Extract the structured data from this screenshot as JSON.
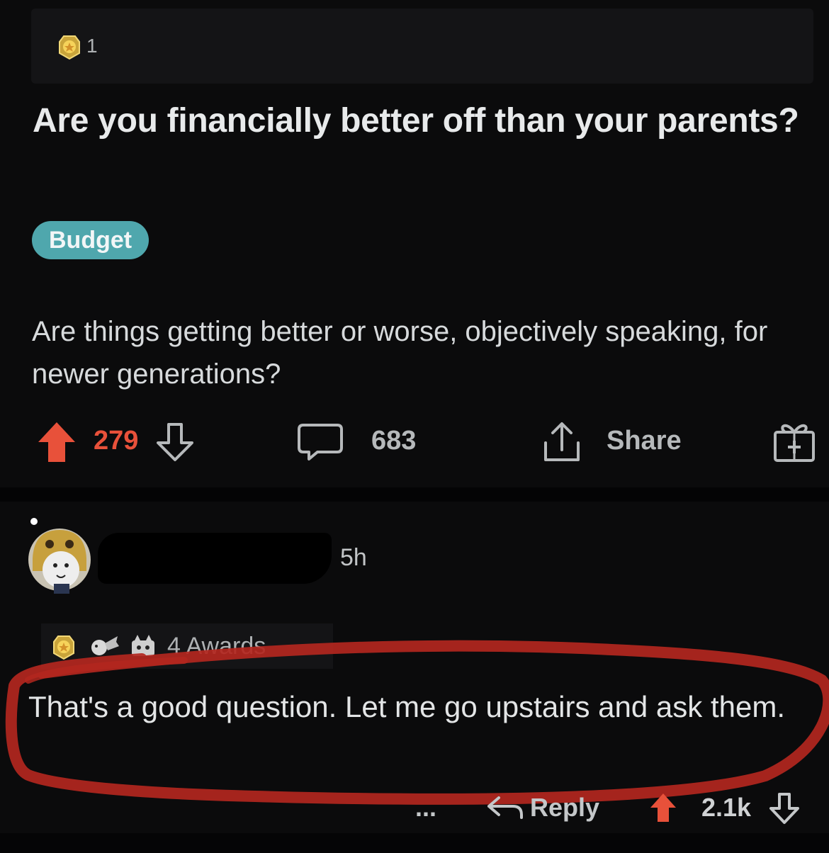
{
  "post": {
    "award_count": "1",
    "title": "Are you financially better off than your parents?",
    "flair": "Budget",
    "body": "Are things getting better or worse, objectively speaking, for newer generations?",
    "score": "279",
    "comments": "683",
    "share_label": "Share",
    "icons": [
      "award-icon",
      "upvote-icon",
      "downvote-icon",
      "comment-icon",
      "share-icon",
      "gift-icon"
    ]
  },
  "comment": {
    "time": "5h",
    "awards_label": "4 Awards",
    "text": "That's a good question. Let me go upstairs and ask them.",
    "more": "...",
    "reply_label": "Reply",
    "score": "2.1k",
    "icons": [
      "avatar",
      "award-icon",
      "award-icon",
      "award-icon",
      "reply-icon",
      "upvote-icon",
      "downvote-icon"
    ]
  },
  "colors": {
    "background": "#0b0b0c",
    "upvote": "#e8513a",
    "flair": "#4fa7ad",
    "highlight_circle": "#b3271f"
  }
}
